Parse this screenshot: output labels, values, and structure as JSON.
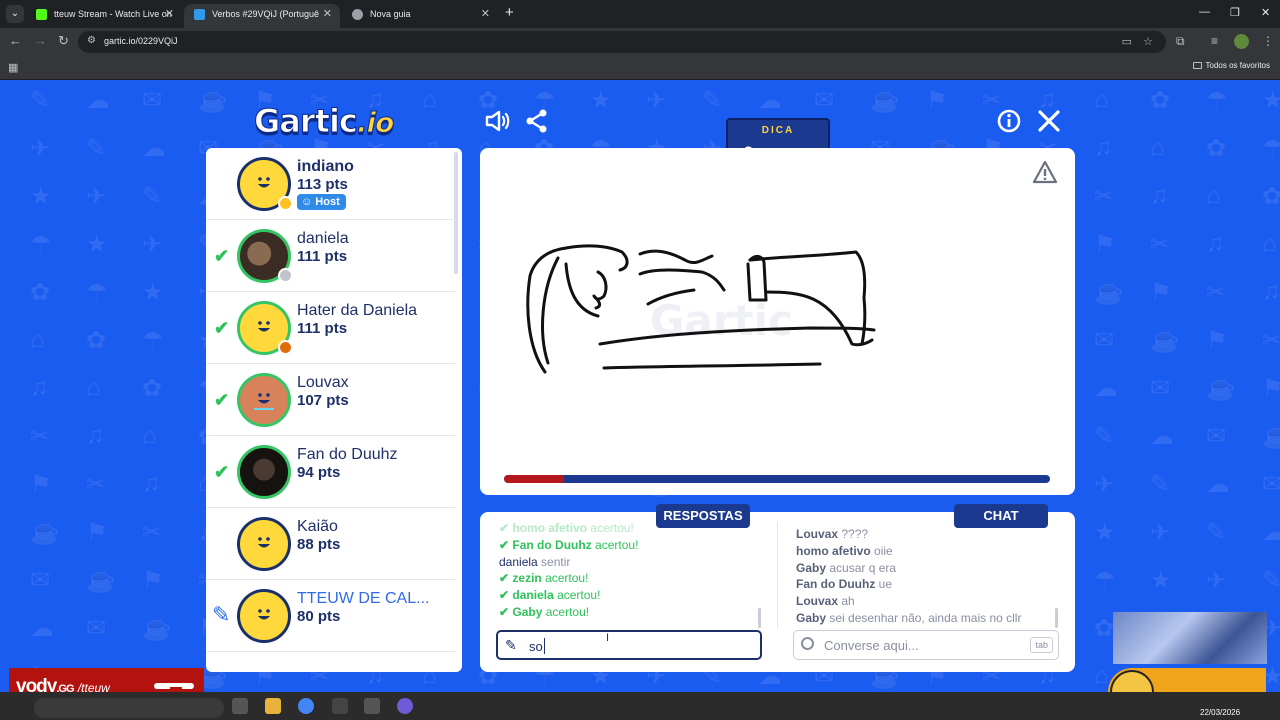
{
  "browser": {
    "tabs": [
      {
        "title": "tteuw Stream - Watch Live on ",
        "favicon_color": "#53fc18",
        "active": false
      },
      {
        "title": "Verbos #29VQiJ (Portuguê",
        "favicon_color": "#2f9be8",
        "active": true
      },
      {
        "title": "Nova guia",
        "favicon_color": "#9aa0a6",
        "active": false
      }
    ],
    "url": "gartic.io/0229VQiJ",
    "bookmarks_folder": "Todos os favoritos"
  },
  "game": {
    "logo_main": "Gartic",
    "logo_suffix": ".io",
    "hint_label": "DICA",
    "hint_text": "s",
    "timer_fraction": 0.11,
    "players": [
      {
        "name": "indiano",
        "points": "113 pts",
        "host_label": "Host",
        "status": "none",
        "avatar": "default",
        "dot_color": "#ffc021"
      },
      {
        "name": "daniela",
        "points": "111 pts",
        "status": "correct",
        "avatar": "photo1",
        "dot_color": "#bfc3cc"
      },
      {
        "name": "Hater da Daniela",
        "points": "111 pts",
        "status": "correct",
        "avatar": "default",
        "dot_color": "#e36c0a"
      },
      {
        "name": "Louvax",
        "points": "107 pts",
        "status": "correct",
        "avatar": "tan"
      },
      {
        "name": "Fan do Duuhz",
        "points": "94 pts",
        "status": "correct",
        "avatar": "photo2"
      },
      {
        "name": "Kaião",
        "points": "88 pts",
        "status": "none",
        "avatar": "default"
      },
      {
        "name": "TTEUW DE CAL...",
        "points": "80 pts",
        "status": "drawing",
        "avatar": "default"
      }
    ],
    "answers_label": "RESPOSTAS",
    "chat_label": "CHAT",
    "answers": [
      {
        "user": "homo afetivo",
        "text": "acertou!",
        "correct": true
      },
      {
        "user": "Fan do Duuhz",
        "text": "acertou!",
        "correct": true
      },
      {
        "user": "daniela",
        "text": "sentir",
        "correct": false
      },
      {
        "user": "zezin",
        "text": "acertou!",
        "correct": true
      },
      {
        "user": "daniela",
        "text": "acertou!",
        "correct": true
      },
      {
        "user": "Gaby",
        "text": "acertou!",
        "correct": true
      }
    ],
    "chat": [
      {
        "user": "Louvax",
        "text": "????"
      },
      {
        "user": "homo afetivo",
        "text": "oiie"
      },
      {
        "user": "Gaby",
        "text": "acusar q era"
      },
      {
        "user": "Fan do Duuhz",
        "text": "ue"
      },
      {
        "user": "Louvax",
        "text": "ah"
      },
      {
        "user": "Gaby",
        "text": "sei desenhar não, ainda mais no cllr"
      }
    ],
    "answer_input_value": "so",
    "chat_placeholder": "Converse aqui...",
    "chat_key_hint": "tab"
  },
  "overlay": {
    "vody_brand": "vody",
    "vody_tld": ".GG",
    "vody_user": "/tteuw"
  },
  "taskbar": {
    "date": "22/03/2026"
  }
}
